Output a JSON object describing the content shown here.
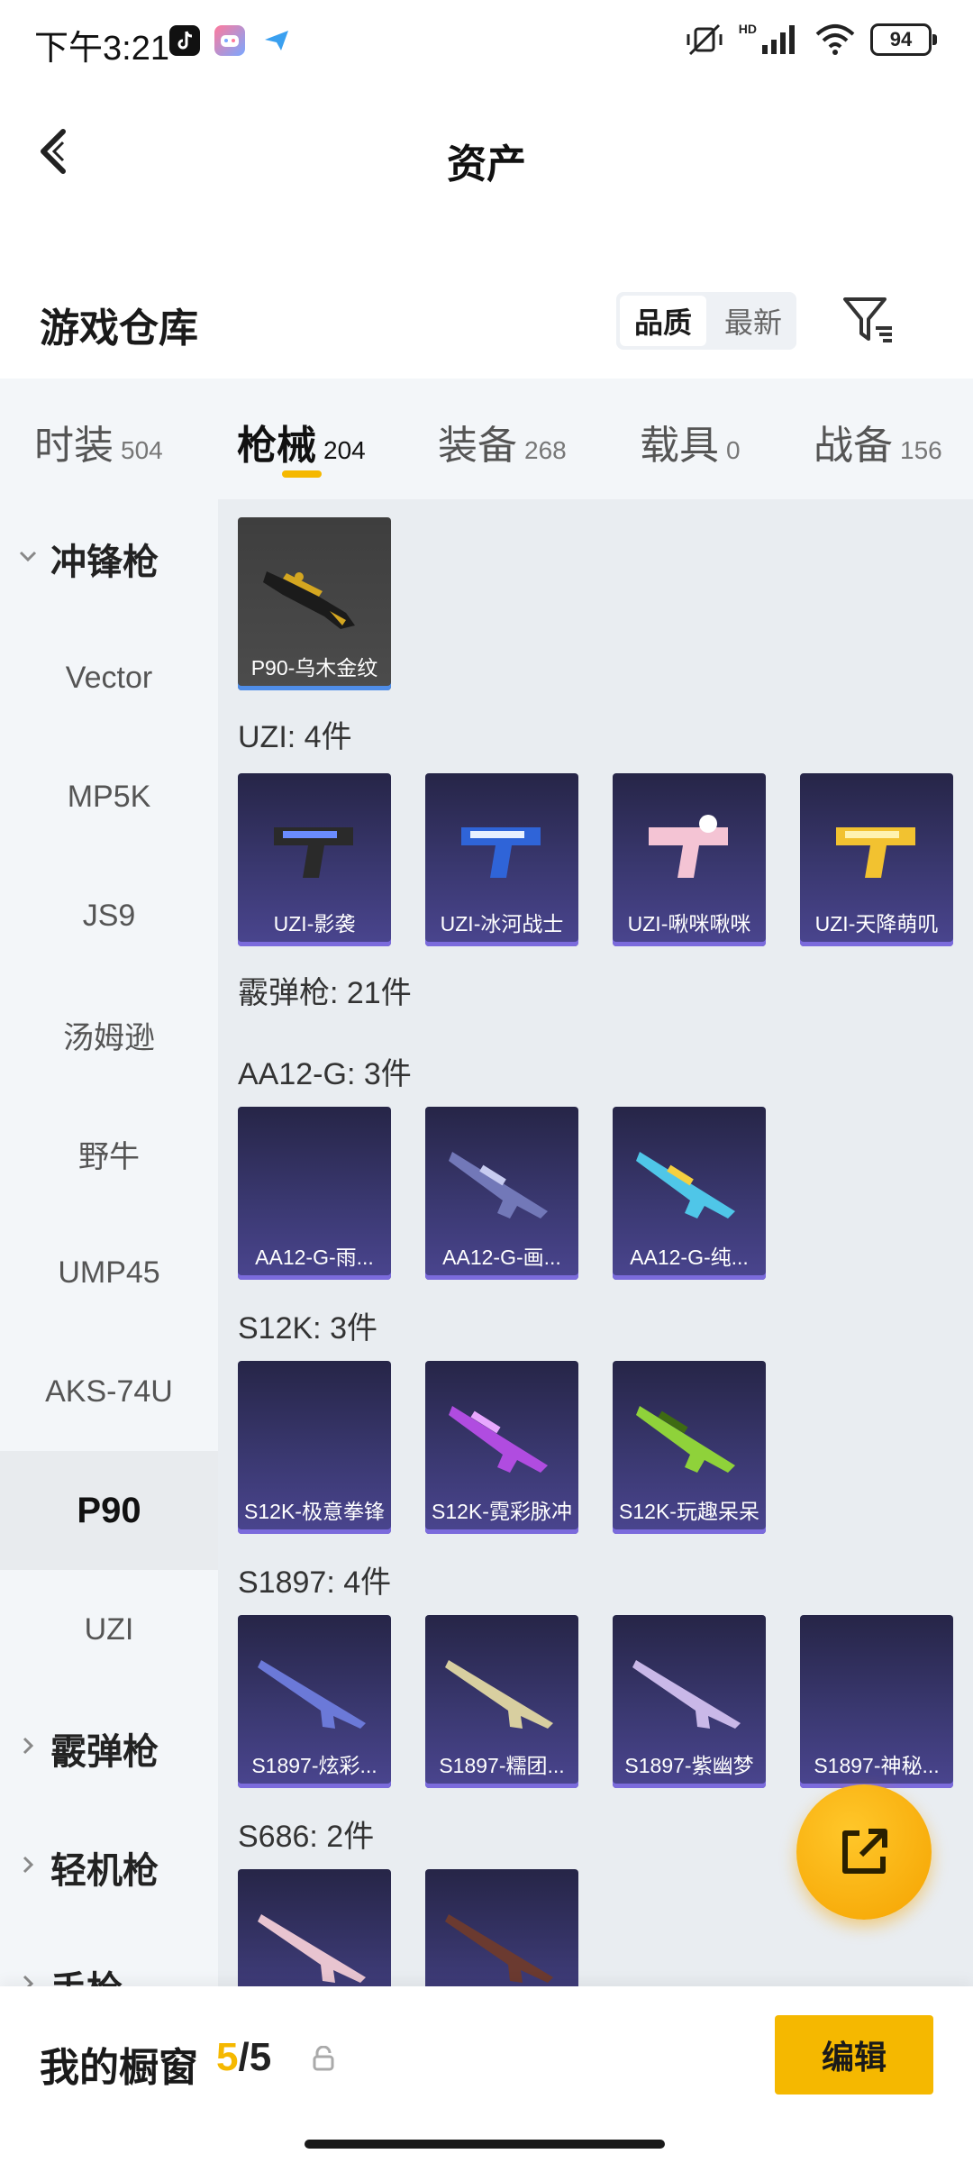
{
  "status_bar": {
    "time": "下午3:21",
    "battery": "94",
    "network": "HD"
  },
  "header": {
    "title": "资产"
  },
  "warehouse": {
    "title": "游戏仓库",
    "sort_options": [
      "品质",
      "最新"
    ],
    "sort_selected": "品质"
  },
  "tabs": [
    {
      "label": "时装",
      "count": "504"
    },
    {
      "label": "枪械",
      "count": "204"
    },
    {
      "label": "装备",
      "count": "268"
    },
    {
      "label": "载具",
      "count": "0"
    },
    {
      "label": "战备",
      "count": "156"
    }
  ],
  "active_tab": "枪械",
  "sidebar": {
    "items": [
      {
        "label": "冲锋枪",
        "type": "group",
        "expanded": true
      },
      {
        "label": "Vector",
        "type": "item"
      },
      {
        "label": "MP5K",
        "type": "item"
      },
      {
        "label": "JS9",
        "type": "item"
      },
      {
        "label": "汤姆逊",
        "type": "item"
      },
      {
        "label": "野牛",
        "type": "item"
      },
      {
        "label": "UMP45",
        "type": "item"
      },
      {
        "label": "AKS-74U",
        "type": "item"
      },
      {
        "label": "P90",
        "type": "item",
        "active": true
      },
      {
        "label": "UZI",
        "type": "item"
      },
      {
        "label": "霰弹枪",
        "type": "group",
        "expanded": false
      },
      {
        "label": "轻机枪",
        "type": "group",
        "expanded": false
      },
      {
        "label": "手枪",
        "type": "group",
        "expanded": false
      }
    ]
  },
  "content": {
    "p90_items": [
      "P90-乌木金纹"
    ],
    "sections": [
      {
        "label": "UZI: 4件",
        "items": [
          "UZI-影袭",
          "UZI-冰河战士",
          "UZI-啾咪啾咪",
          "UZI-天降萌叽"
        ]
      },
      {
        "label": "霰弹枪: 21件",
        "items": []
      },
      {
        "label": "AA12-G: 3件",
        "items": [
          "AA12-G-雨...",
          "AA12-G-画...",
          "AA12-G-纯..."
        ]
      },
      {
        "label": "S12K: 3件",
        "items": [
          "S12K-极意拳锋",
          "S12K-霓彩脉冲",
          "S12K-玩趣呆呆"
        ]
      },
      {
        "label": "S1897: 4件",
        "items": [
          "S1897-炫彩...",
          "S1897-糯团...",
          "S1897-紫幽梦",
          "S1897-神秘..."
        ]
      },
      {
        "label": "S686: 2件",
        "items": [
          "",
          ""
        ]
      }
    ]
  },
  "bottom_bar": {
    "label": "我的橱窗",
    "count_current": "5",
    "count_total": "/5",
    "edit_label": "编辑"
  },
  "colors": {
    "accent": "#f5b800",
    "tab_bg": "#f3f6f9",
    "content_bg": "#e9edf1",
    "card_top": "#262547",
    "card_bottom": "#4a458f"
  }
}
